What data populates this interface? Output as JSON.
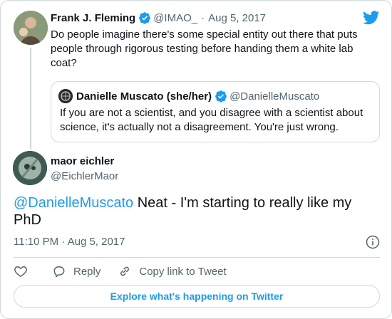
{
  "parent_tweet": {
    "author_name": "Frank J. Fleming",
    "author_handle": "@IMAO_",
    "separator": "·",
    "date": "Aug 5, 2017",
    "text": "Do people imagine there's some special entity out there that puts people through rigorous testing before handing them a white lab coat?",
    "quoted_tweet": {
      "author_name": "Danielle Muscato (she/her)",
      "author_handle": "@DanielleMuscato",
      "text": "If you are not a scientist, and you disagree with a scientist about science, it's actually not a disagreement. You're just wrong."
    }
  },
  "main_tweet": {
    "author_name": "maor eichler",
    "author_handle": "@EichlerMaor",
    "mention": "@DanielleMuscato",
    "text": " Neat - I'm starting to really like my PhD",
    "time": "11:10 PM · Aug 5, 2017"
  },
  "actions": {
    "reply_label": "Reply",
    "copy_link_label": "Copy link to Tweet"
  },
  "explore_label": "Explore what's happening on Twitter",
  "colors": {
    "accent": "#1d9bf0",
    "muted": "#536471",
    "border": "#cfd9de"
  },
  "icons": [
    "twitter-bird-icon",
    "verified-badge-icon",
    "info-icon",
    "heart-icon",
    "reply-icon",
    "link-icon"
  ]
}
